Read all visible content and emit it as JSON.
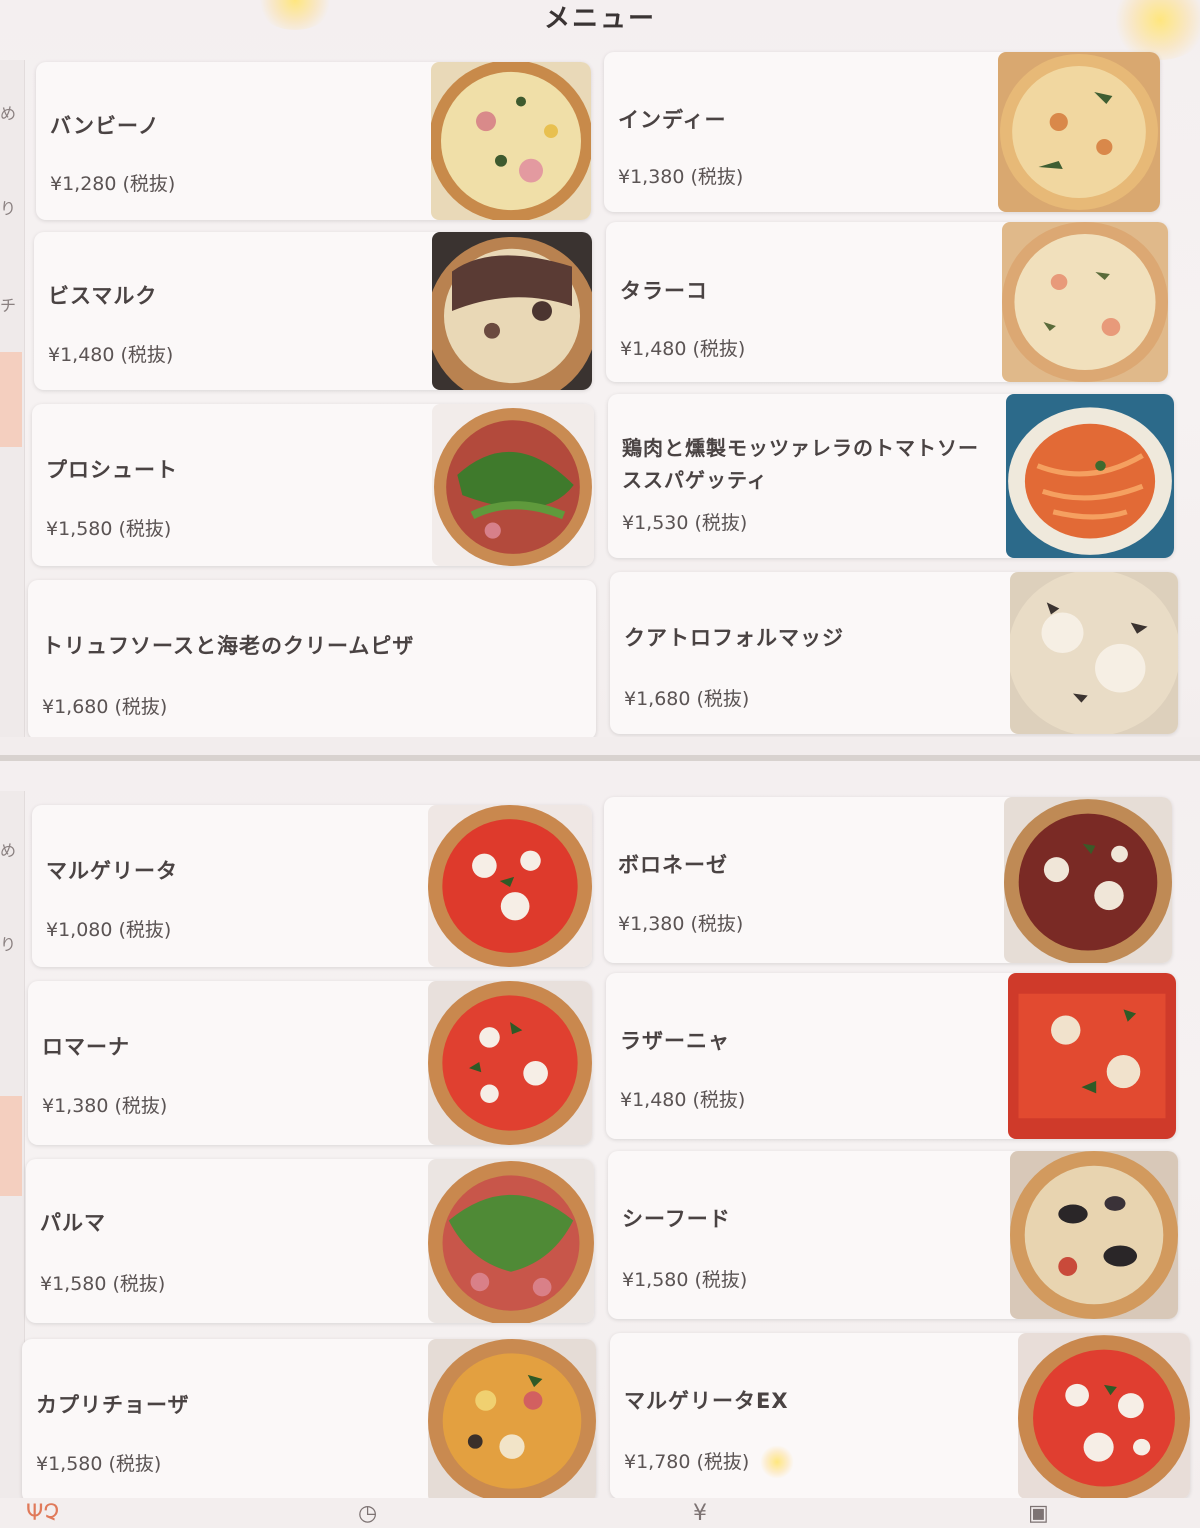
{
  "header": {
    "title": "メニュー"
  },
  "sidebar": {
    "tabs": [
      "め",
      "り",
      "チ"
    ]
  },
  "top_menu": [
    {
      "name": "バンビーノ",
      "price": "¥1,280 (税抜)"
    },
    {
      "name": "インディー",
      "price": "¥1,380 (税抜)"
    },
    {
      "name": "ビスマルク",
      "price": "¥1,480 (税抜)"
    },
    {
      "name": "タラーコ",
      "price": "¥1,480 (税抜)"
    },
    {
      "name": "プロシュート",
      "price": "¥1,580 (税抜)"
    },
    {
      "name": "鶏肉と燻製モッツァレラのトマトソーススパゲッティ",
      "price": "¥1,530 (税抜)"
    },
    {
      "name": "トリュフソースと海老のクリームピザ",
      "price": "¥1,680 (税抜)"
    },
    {
      "name": "クアトロフォルマッジ",
      "price": "¥1,680 (税抜)"
    }
  ],
  "bottom_menu": [
    {
      "name": "マルゲリータ",
      "price": "¥1,080 (税抜)"
    },
    {
      "name": "ボロネーゼ",
      "price": "¥1,380 (税抜)"
    },
    {
      "name": "ロマーナ",
      "price": "¥1,380 (税抜)"
    },
    {
      "name": "ラザーニャ",
      "price": "¥1,480 (税抜)"
    },
    {
      "name": "パルマ",
      "price": "¥1,580 (税抜)"
    },
    {
      "name": "シーフード",
      "price": "¥1,580 (税抜)"
    },
    {
      "name": "カプリチョーザ",
      "price": "¥1,580 (税抜)"
    },
    {
      "name": "マルゲリータEX",
      "price": "¥1,780 (税抜)"
    }
  ],
  "bottom_nav": [
    {
      "icon": "menu-icon",
      "glyph": "ΨՉ"
    },
    {
      "icon": "history-icon",
      "glyph": "◷"
    },
    {
      "icon": "bill-icon",
      "glyph": "¥"
    },
    {
      "icon": "qr-icon",
      "glyph": "▣"
    }
  ],
  "colors": {
    "accent": "#f4cfbf",
    "text": "#4a4343"
  }
}
